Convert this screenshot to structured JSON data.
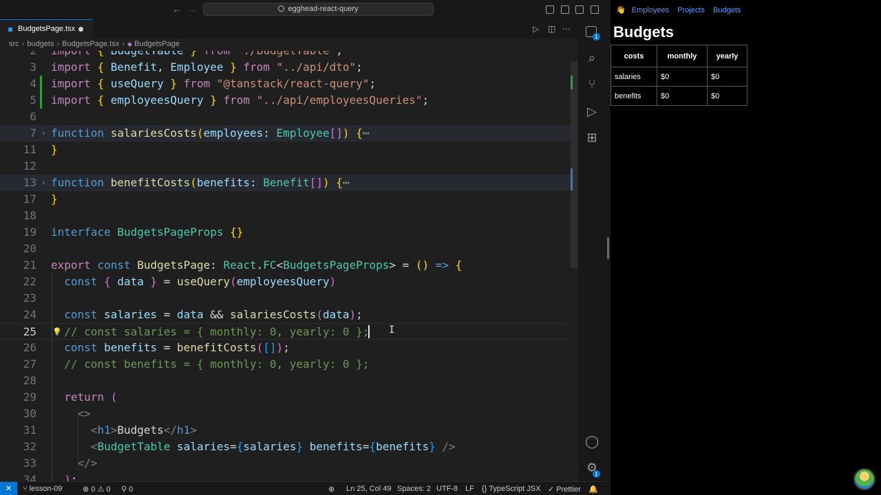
{
  "vscode": {
    "title": "egghead-react-query",
    "tab": {
      "label": "BudgetsPage.tsx",
      "modified": true
    },
    "breadcrumbs": [
      "src",
      "budgets",
      "BudgetsPage.tsx",
      "BudgetsPage"
    ],
    "status": {
      "branch": "lesson-09",
      "errors": "0",
      "warnings": "0",
      "ports": "0",
      "position": "Ln 25, Col 49",
      "spaces": "Spaces: 2",
      "encoding": "UTF-8",
      "eol": "LF",
      "language": "TypeScript JSX",
      "formatter": "Prettier"
    },
    "badges": {
      "explorer": "1",
      "settings": "1"
    },
    "line_numbers": [
      "2",
      "3",
      "4",
      "5",
      "6",
      "7",
      "11",
      "12",
      "13",
      "17",
      "18",
      "19",
      "20",
      "21",
      "22",
      "23",
      "24",
      "25",
      "26",
      "27",
      "28",
      "29",
      "30",
      "31",
      "32",
      "33",
      "34"
    ],
    "active_line": "25"
  },
  "preview": {
    "nav_icon": "wave-hand-icon",
    "nav": [
      "Employees",
      "Projects",
      "Budgets"
    ],
    "title": "Budgets",
    "table": {
      "headers": [
        "costs",
        "monthly",
        "yearly"
      ],
      "rows": [
        [
          "salaries",
          "$0",
          "$0"
        ],
        [
          "benefits",
          "$0",
          "$0"
        ]
      ]
    }
  },
  "colors": {
    "accent": "#0078d4",
    "link": "#5b9bff",
    "added": "#2ea043"
  }
}
